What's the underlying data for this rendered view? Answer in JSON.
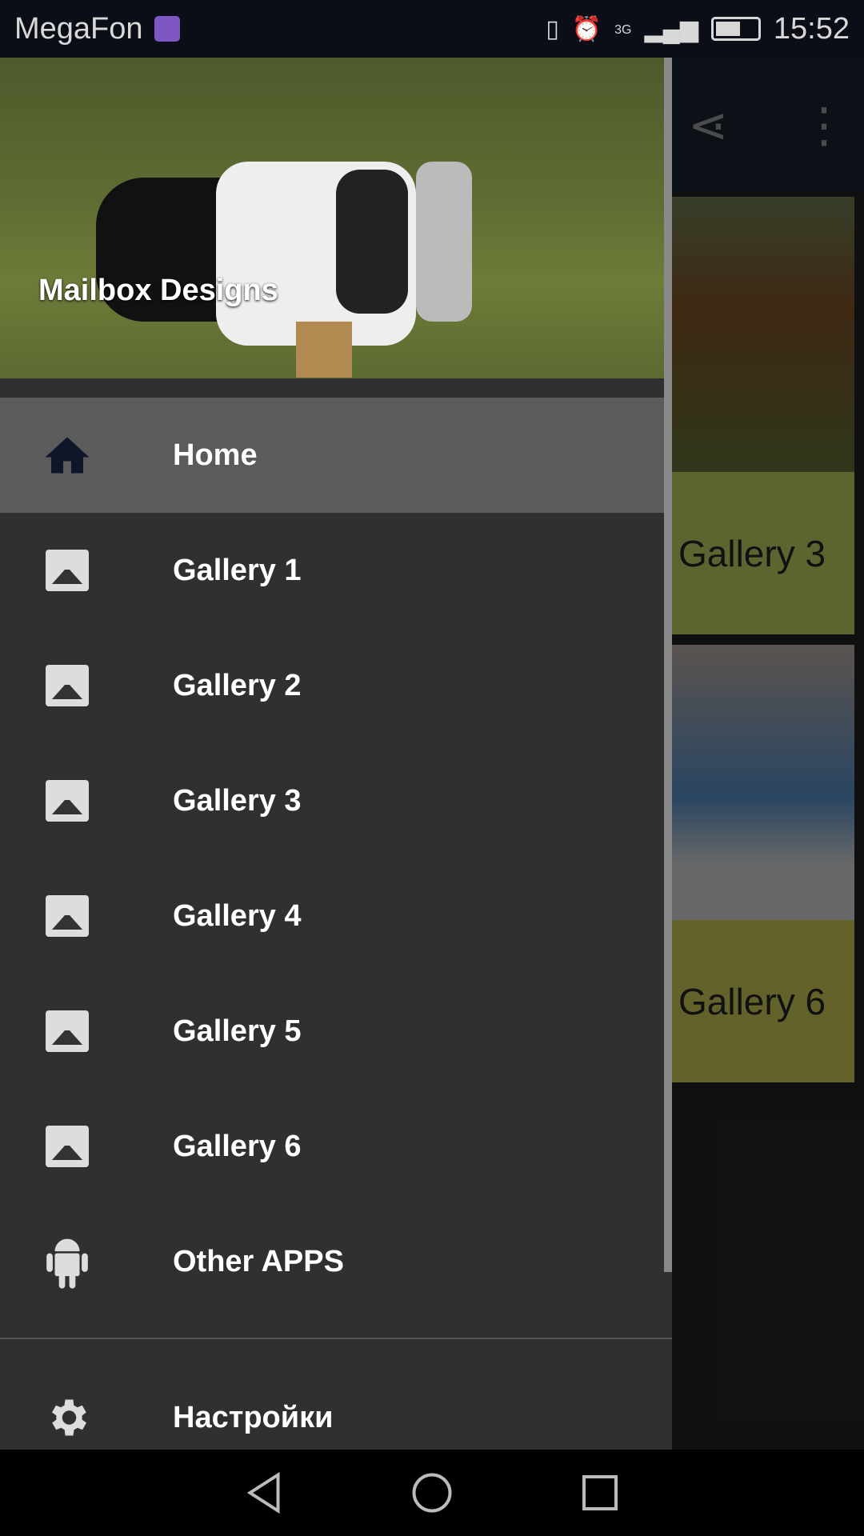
{
  "status_bar": {
    "carrier": "MegaFon",
    "network": "3G",
    "time": "15:52"
  },
  "background": {
    "cards": [
      {
        "label": "Gallery 3"
      },
      {
        "label": "Gallery 6"
      }
    ],
    "toolbar_icons": [
      "share-icon",
      "more-vert-icon"
    ]
  },
  "drawer": {
    "header_title": "Mailbox Designs",
    "items": [
      {
        "label": "Home",
        "icon": "home-icon"
      },
      {
        "label": "Gallery 1",
        "icon": "image-icon"
      },
      {
        "label": "Gallery 2",
        "icon": "image-icon"
      },
      {
        "label": "Gallery 3",
        "icon": "image-icon"
      },
      {
        "label": "Gallery 4",
        "icon": "image-icon"
      },
      {
        "label": "Gallery 5",
        "icon": "image-icon"
      },
      {
        "label": "Gallery 6",
        "icon": "image-icon"
      },
      {
        "label": "Other APPS",
        "icon": "android-icon"
      }
    ],
    "settings": {
      "label": "Настройки",
      "icon": "gear-icon"
    }
  },
  "colors": {
    "drawer_bg": "#303030",
    "active_item": "#5b5b5b",
    "card_label_bg": "#8c9a2c"
  }
}
